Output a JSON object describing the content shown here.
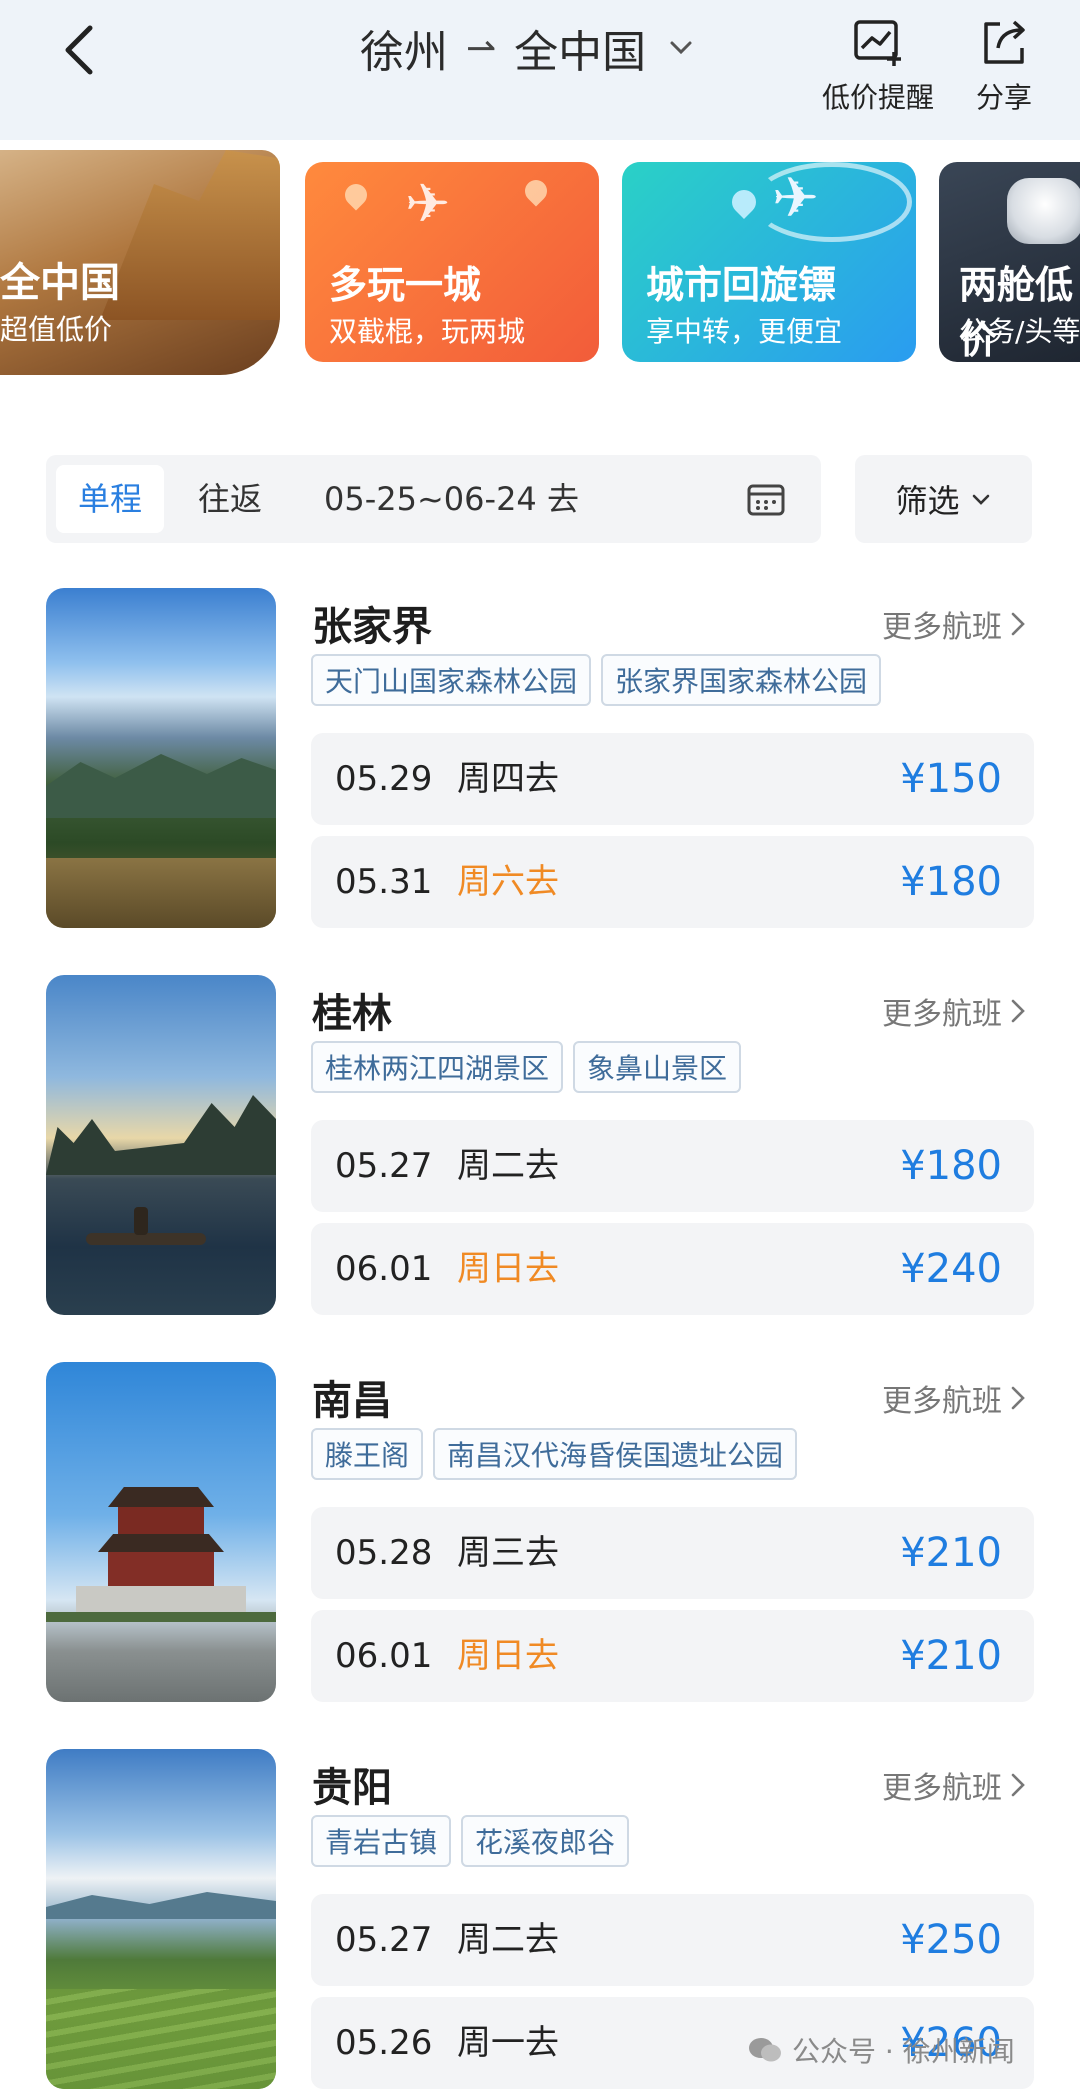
{
  "header": {
    "from": "徐州",
    "to": "全中国",
    "actions": [
      {
        "label": "低价提醒",
        "icon": "price-alert-icon"
      },
      {
        "label": "分享",
        "icon": "share-icon"
      }
    ]
  },
  "promos": [
    {
      "title": "全中国",
      "subtitle": "超值低价"
    },
    {
      "title": "多玩一城",
      "subtitle": "双截棍，玩两城"
    },
    {
      "title": "城市回旋镖",
      "subtitle": "享中转，更便宜"
    },
    {
      "title": "两舱低价",
      "subtitle": "公务/头等"
    }
  ],
  "filter": {
    "tabs": [
      "单程",
      "往返"
    ],
    "active_tab": "单程",
    "date_range": "05-25~06-24 去",
    "filter_label": "筛选"
  },
  "destinations": [
    {
      "city": "张家界",
      "more": "更多航班",
      "tags": [
        "天门山国家森林公园",
        "张家界国家森林公园"
      ],
      "flights": [
        {
          "date": "05.29",
          "dow": "周四去",
          "weekend": false,
          "price": "¥150"
        },
        {
          "date": "05.31",
          "dow": "周六去",
          "weekend": true,
          "price": "¥180"
        }
      ]
    },
    {
      "city": "桂林",
      "more": "更多航班",
      "tags": [
        "桂林两江四湖景区",
        "象鼻山景区"
      ],
      "flights": [
        {
          "date": "05.27",
          "dow": "周二去",
          "weekend": false,
          "price": "¥180"
        },
        {
          "date": "06.01",
          "dow": "周日去",
          "weekend": true,
          "price": "¥240"
        }
      ]
    },
    {
      "city": "南昌",
      "more": "更多航班",
      "tags": [
        "滕王阁",
        "南昌汉代海昏侯国遗址公园"
      ],
      "flights": [
        {
          "date": "05.28",
          "dow": "周三去",
          "weekend": false,
          "price": "¥210"
        },
        {
          "date": "06.01",
          "dow": "周日去",
          "weekend": true,
          "price": "¥210"
        }
      ]
    },
    {
      "city": "贵阳",
      "more": "更多航班",
      "tags": [
        "青岩古镇",
        "花溪夜郎谷"
      ],
      "flights": [
        {
          "date": "05.27",
          "dow": "周二去",
          "weekend": false,
          "price": "¥250"
        },
        {
          "date": "05.26",
          "dow": "周一去",
          "weekend": false,
          "price": "¥260"
        }
      ]
    }
  ],
  "colors": {
    "accent": "#2a7fe0",
    "weekend": "#f08a24",
    "price": "#1f7de0"
  },
  "watermark": "公众号 · 徐州新闻"
}
